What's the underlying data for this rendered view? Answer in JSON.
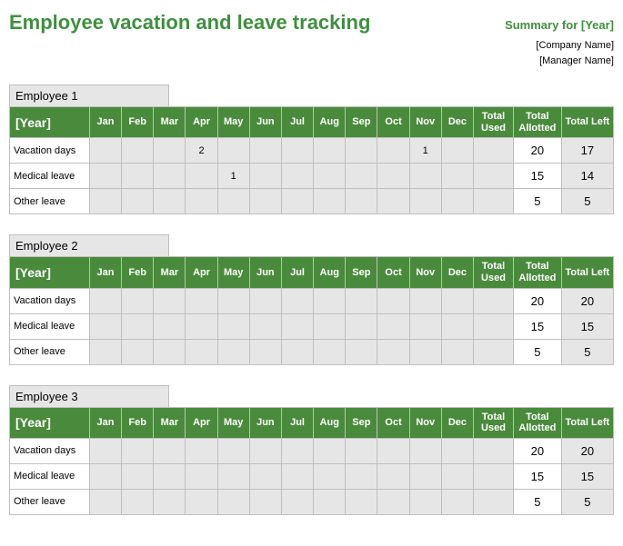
{
  "header": {
    "title": "Employee vacation and leave tracking",
    "summary": "Summary for [Year]",
    "company": "[Company Name]",
    "manager": "[Manager Name]"
  },
  "columns": {
    "year": "[Year]",
    "months": [
      "Jan",
      "Feb",
      "Mar",
      "Apr",
      "May",
      "Jun",
      "Jul",
      "Aug",
      "Sep",
      "Oct",
      "Nov",
      "Dec"
    ],
    "total_used": "Total Used",
    "total_allotted": "Total Allotted",
    "total_left": "Total Left"
  },
  "row_labels": {
    "vacation": "Vacation days",
    "medical": "Medical leave",
    "other": "Other leave"
  },
  "employees": [
    {
      "name": "Employee 1",
      "rows": [
        {
          "type": "vacation",
          "months": [
            "",
            "",
            "",
            "2",
            "",
            "",
            "",
            "",
            "",
            "",
            "1",
            ""
          ],
          "used": "",
          "allotted": "20",
          "left": "17"
        },
        {
          "type": "medical",
          "months": [
            "",
            "",
            "",
            "",
            "1",
            "",
            "",
            "",
            "",
            "",
            "",
            ""
          ],
          "used": "",
          "allotted": "15",
          "left": "14"
        },
        {
          "type": "other",
          "months": [
            "",
            "",
            "",
            "",
            "",
            "",
            "",
            "",
            "",
            "",
            "",
            ""
          ],
          "used": "",
          "allotted": "5",
          "left": "5"
        }
      ]
    },
    {
      "name": "Employee 2",
      "rows": [
        {
          "type": "vacation",
          "months": [
            "",
            "",
            "",
            "",
            "",
            "",
            "",
            "",
            "",
            "",
            "",
            ""
          ],
          "used": "",
          "allotted": "20",
          "left": "20"
        },
        {
          "type": "medical",
          "months": [
            "",
            "",
            "",
            "",
            "",
            "",
            "",
            "",
            "",
            "",
            "",
            ""
          ],
          "used": "",
          "allotted": "15",
          "left": "15"
        },
        {
          "type": "other",
          "months": [
            "",
            "",
            "",
            "",
            "",
            "",
            "",
            "",
            "",
            "",
            "",
            ""
          ],
          "used": "",
          "allotted": "5",
          "left": "5"
        }
      ]
    },
    {
      "name": "Employee 3",
      "rows": [
        {
          "type": "vacation",
          "months": [
            "",
            "",
            "",
            "",
            "",
            "",
            "",
            "",
            "",
            "",
            "",
            ""
          ],
          "used": "",
          "allotted": "20",
          "left": "20"
        },
        {
          "type": "medical",
          "months": [
            "",
            "",
            "",
            "",
            "",
            "",
            "",
            "",
            "",
            "",
            "",
            ""
          ],
          "used": "",
          "allotted": "15",
          "left": "15"
        },
        {
          "type": "other",
          "months": [
            "",
            "",
            "",
            "",
            "",
            "",
            "",
            "",
            "",
            "",
            "",
            ""
          ],
          "used": "",
          "allotted": "5",
          "left": "5"
        }
      ]
    }
  ]
}
